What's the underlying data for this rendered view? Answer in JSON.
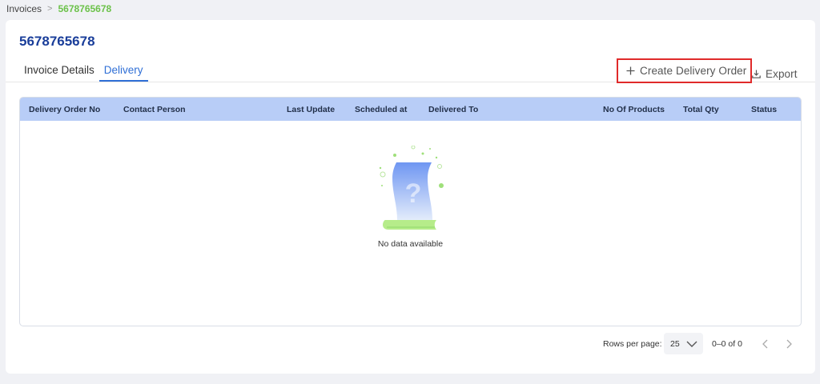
{
  "breadcrumb": {
    "root": "Invoices",
    "current": "5678765678"
  },
  "page": {
    "title": "5678765678"
  },
  "tabs": [
    {
      "label": "Invoice Details",
      "active": false
    },
    {
      "label": "Delivery",
      "active": true
    }
  ],
  "actions": {
    "create_label": "Create Delivery Order",
    "create_icon": "plus-icon",
    "export_label": "Export",
    "export_icon": "download-icon"
  },
  "table": {
    "columns": [
      "Delivery Order No",
      "Contact Person",
      "Last Update",
      "Scheduled at",
      "Delivered To",
      "No Of Products",
      "Total Qty",
      "Status"
    ],
    "rows": [],
    "empty_text": "No data available"
  },
  "pagination": {
    "rows_per_page_label": "Rows per page:",
    "rows_per_page_value": "25",
    "range_text": "0–0 of 0"
  },
  "colors": {
    "brand_title": "#1a3e9a",
    "accent_tab": "#2f6fd6",
    "breadcrumb_current": "#6cc24a",
    "table_header_bg": "#b8cdf7",
    "highlight_border": "#e02a2a"
  }
}
